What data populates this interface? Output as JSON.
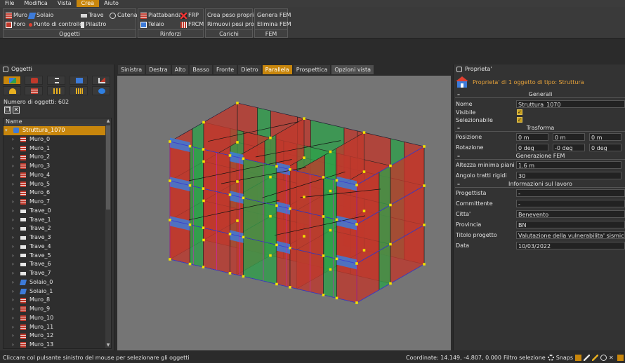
{
  "menu": [
    "File",
    "Modifica",
    "Vista",
    "Crea",
    "Aiuto"
  ],
  "menu_active": "Crea",
  "ribbon": {
    "oggetti": {
      "title": "Oggetti",
      "muro": "Muro",
      "solaio": "Solaio",
      "trave": "Trave",
      "catena": "Catena",
      "foro": "Foro",
      "punto": "Punto di controllo",
      "pilastro": "Pilastro"
    },
    "rinforzi": {
      "title": "Rinforzi",
      "piattabanda": "Piattabanda",
      "frp": "FRP",
      "telaio": "Telaio",
      "frcm": "FRCM"
    },
    "carichi": {
      "title": "Carichi",
      "crea_peso": "Crea peso proprio",
      "rimuovi_pesi": "Rimuovi pesi propri"
    },
    "fem": {
      "title": "FEM",
      "genera": "Genera FEM",
      "elimina": "Elimina FEM"
    }
  },
  "left_panel": {
    "title": "Oggetti",
    "count_label": "Numero di oggetti: 602",
    "tree_header": "Name",
    "root": "Struttura_1070",
    "items": [
      {
        "name": "Muro_0",
        "type": "muro"
      },
      {
        "name": "Muro_1",
        "type": "muro"
      },
      {
        "name": "Muro_2",
        "type": "muro"
      },
      {
        "name": "Muro_3",
        "type": "muro"
      },
      {
        "name": "Muro_4",
        "type": "muro"
      },
      {
        "name": "Muro_5",
        "type": "muro"
      },
      {
        "name": "Muro_6",
        "type": "muro"
      },
      {
        "name": "Muro_7",
        "type": "muro"
      },
      {
        "name": "Trave_0",
        "type": "trave"
      },
      {
        "name": "Trave_1",
        "type": "trave"
      },
      {
        "name": "Trave_2",
        "type": "trave"
      },
      {
        "name": "Trave_3",
        "type": "trave"
      },
      {
        "name": "Trave_4",
        "type": "trave"
      },
      {
        "name": "Trave_5",
        "type": "trave"
      },
      {
        "name": "Trave_6",
        "type": "trave"
      },
      {
        "name": "Trave_7",
        "type": "trave"
      },
      {
        "name": "Solaio_0",
        "type": "solaio"
      },
      {
        "name": "Solaio_1",
        "type": "solaio"
      },
      {
        "name": "Muro_8",
        "type": "muro"
      },
      {
        "name": "Muro_9",
        "type": "muro"
      },
      {
        "name": "Muro_10",
        "type": "muro"
      },
      {
        "name": "Muro_11",
        "type": "muro"
      },
      {
        "name": "Muro_12",
        "type": "muro"
      },
      {
        "name": "Muro_13",
        "type": "muro"
      }
    ]
  },
  "view_tabs": [
    "Sinistra",
    "Destra",
    "Alto",
    "Basso",
    "Fronte",
    "Dietro",
    "Parallela",
    "Prospettica",
    "Opzioni vista"
  ],
  "view_active": "Parallela",
  "props": {
    "title": "Proprieta'",
    "subtitle": "Proprieta' di 1 oggetto di tipo: Struttura",
    "generali": {
      "title": "Generali",
      "nome_label": "Nome",
      "nome": "Struttura_1070",
      "visibile_label": "Visibile",
      "selezionabile_label": "Selezionabile"
    },
    "trasforma": {
      "title": "Trasforma",
      "posizione_label": "Posizione",
      "pos": [
        "0 m",
        "0 m",
        "0 m"
      ],
      "rotazione_label": "Rotazione",
      "rot": [
        "0 deg",
        "-0 deg",
        "0 deg"
      ]
    },
    "fem": {
      "title": "Generazione FEM",
      "altezza_label": "Altezza minima piani",
      "altezza": "1.6 m",
      "angolo_label": "Angolo tratti rigidi",
      "angolo": "30"
    },
    "info": {
      "title": "Informazioni sul lavoro",
      "progettista_label": "Progettista",
      "progettista": "-",
      "committente_label": "Committente",
      "committente": "-",
      "citta_label": "Citta'",
      "citta": "Benevento",
      "provincia_label": "Provincia",
      "provincia": "BN",
      "titolo_label": "Titolo progetto",
      "titolo": "Valutazione della vulnerabilita' sismica di un e",
      "data_label": "Data",
      "data": "10/03/2022"
    }
  },
  "status": {
    "message": "Cliccare col pulsante sinistro del mouse per selezionare gli oggetti",
    "coords": "Coordinate: 14.149, -4.807, 0.000",
    "filter": "Filtro selezione",
    "snaps": "Snaps"
  },
  "colors": {
    "accent": "#c8860c",
    "wall_red": "#c0392b",
    "slab_blue": "#3d7bd9",
    "green": "#2fa04a",
    "node_yellow": "#f2e200"
  }
}
